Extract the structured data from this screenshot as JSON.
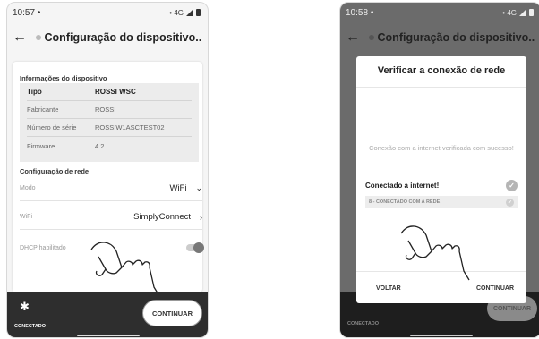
{
  "left": {
    "status": {
      "time": "10:57",
      "dot": "•",
      "net": "• 4G"
    },
    "appbar": {
      "title": "Configuração do dispositivo..."
    },
    "device_info": {
      "section_title": "Informações do dispositivo",
      "rows": [
        {
          "k": "Tipo",
          "v": "ROSSI WSC"
        },
        {
          "k": "Fabricante",
          "v": "ROSSI"
        },
        {
          "k": "Número de série",
          "v": "ROSSIW1ASCTEST02"
        },
        {
          "k": "Firmware",
          "v": "4.2"
        }
      ]
    },
    "network": {
      "section_title": "Configuração de rede",
      "mode_label": "Modo",
      "mode_value": "WiFi",
      "wifi_label": "WiFi",
      "wifi_value": "SimplyConnect",
      "dhcp_label": "DHCP habilitado"
    },
    "bottom": {
      "connection": "CONECTADO",
      "continue": "CONTINUAR"
    }
  },
  "right": {
    "status": {
      "time": "10:58",
      "dot": "•",
      "net": "• 4G"
    },
    "appbar": {
      "title": "Configuração do dispositivo..."
    },
    "dialog": {
      "title": "Verificar a conexão de rede",
      "message": "Conexão com a internet verificada com sucesso!",
      "status_label": "Conectado a internet!",
      "code": "8 - CONECTADO COM A  REDE",
      "back": "VOLTAR",
      "continue": "CONTINUAR"
    },
    "bottom": {
      "connection": "CONECTADO",
      "continue": "CONTINUAR"
    }
  },
  "icons": {
    "back": "arrow-left-icon",
    "bluetooth": "bluetooth-icon",
    "hand": "pointing-hand-icon",
    "check": "check-icon"
  }
}
